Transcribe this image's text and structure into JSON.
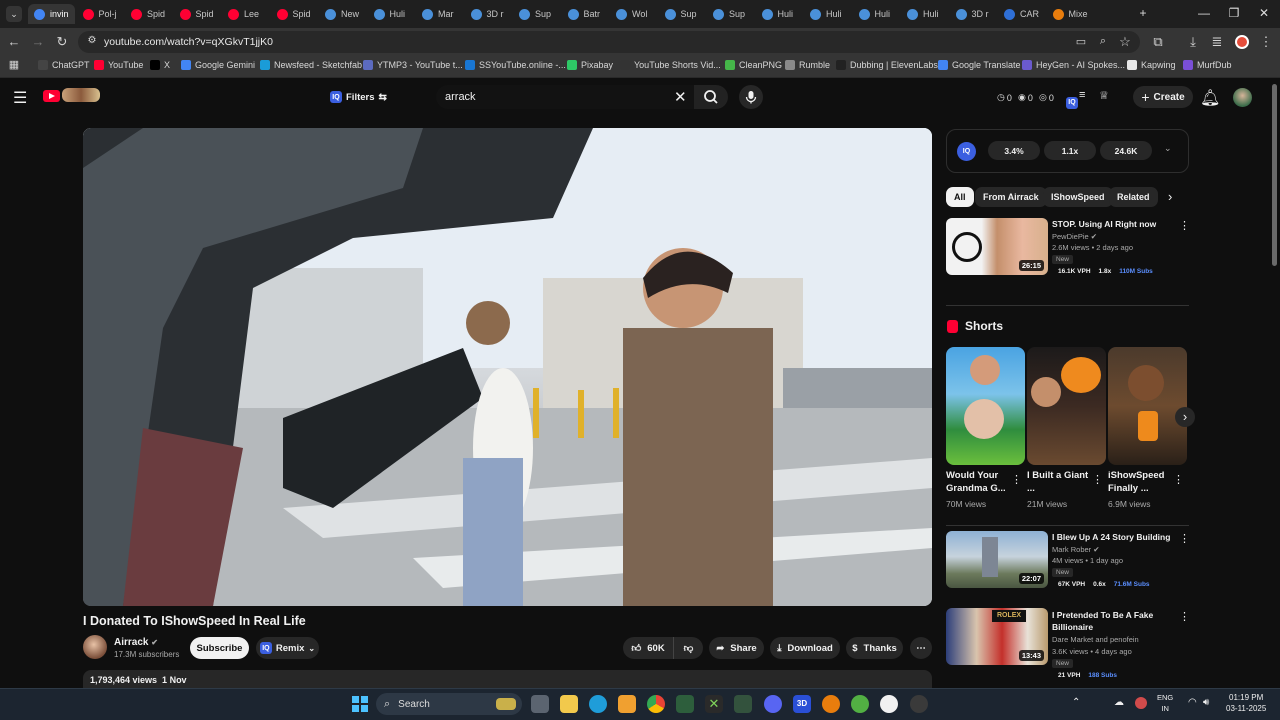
{
  "browser": {
    "tabs": [
      "invin",
      "Pol-j",
      "Spid",
      "Spid",
      "Lee",
      "Spid",
      "New",
      "Huli",
      "Mar",
      "3D r",
      "Sup",
      "Batr",
      "Wol",
      "Sup",
      "Sup",
      "Huli",
      "Huli",
      "Huli",
      "Huli",
      "3D r",
      "CAR",
      "Mixe"
    ],
    "url": "youtube.com/watch?v=qXGkvT1jjK0",
    "bookmarks": [
      "ChatGPT",
      "YouTube",
      "X",
      "Google Gemini",
      "Newsfeed - Sketchfab",
      "YTMP3 - YouTube t...",
      "SSYouTube.online -...",
      "Pixabay",
      "YouTube Shorts Vid...",
      "CleanPNG",
      "Rumble",
      "Dubbing | ElevenLabs",
      "Google Translate",
      "HeyGen - AI Spokes...",
      "Kapwing",
      "MurfDub"
    ],
    "colors": {
      "accent": "#3b5fe0",
      "yt_red": "#ff0033",
      "bg": "#0f0f0f"
    }
  },
  "masthead": {
    "filters_label": "Filters",
    "search_value": "arrack",
    "counters": [
      "0",
      "0",
      "0"
    ],
    "create_label": "Create"
  },
  "video": {
    "title": "I Donated To IShowSpeed In Real Life",
    "channel": "Airrack",
    "subscribers": "17.3M subscribers",
    "subscribe_label": "Subscribe",
    "remix_label": "Remix",
    "likes": "60K",
    "share_label": "Share",
    "download_label": "Download",
    "thanks_label": "Thanks",
    "description_summary": "1,793,464 views  1 Nov"
  },
  "iq_panel": {
    "stats": [
      "3.4%",
      "1.1x",
      "24.6K"
    ]
  },
  "chips": [
    "All",
    "From Airrack",
    "IShowSpeed",
    "Related"
  ],
  "recommended": [
    {
      "title": "STOP. Using AI Right now",
      "channel": "PewDiePie",
      "meta": "2.6M views • 2 days ago",
      "badge": "New",
      "duration": "26:15",
      "vph": "16.1K VPH",
      "ratio": "1.8x",
      "subs": "110M Subs"
    },
    {
      "title": "I Blew Up A 24 Story Building",
      "channel": "Mark Rober",
      "meta": "4M views • 1 day ago",
      "badge": "New",
      "duration": "22:07",
      "vph": "67K VPH",
      "ratio": "0.6x",
      "subs": "71.6M Subs"
    },
    {
      "title": "I Pretended To Be A Fake Billionaire",
      "channel": "Dare Market and penofein",
      "meta": "3.6K views • 4 days ago",
      "badge": "New",
      "duration": "13:43",
      "vph": "21 VPH",
      "ratio": "",
      "subs": "188 Subs"
    }
  ],
  "shorts": {
    "heading": "Shorts",
    "items": [
      {
        "title": "Would Your Grandma G...",
        "views": "70M views"
      },
      {
        "title": "I Built a Giant ...",
        "views": "21M views"
      },
      {
        "title": "iShowSpeed Finally ...",
        "views": "6.9M views"
      }
    ]
  },
  "taskbar": {
    "search_label": "Search",
    "lang": [
      "ENG",
      "IN"
    ],
    "time": "01:19 PM",
    "date": "03-11-2025"
  }
}
